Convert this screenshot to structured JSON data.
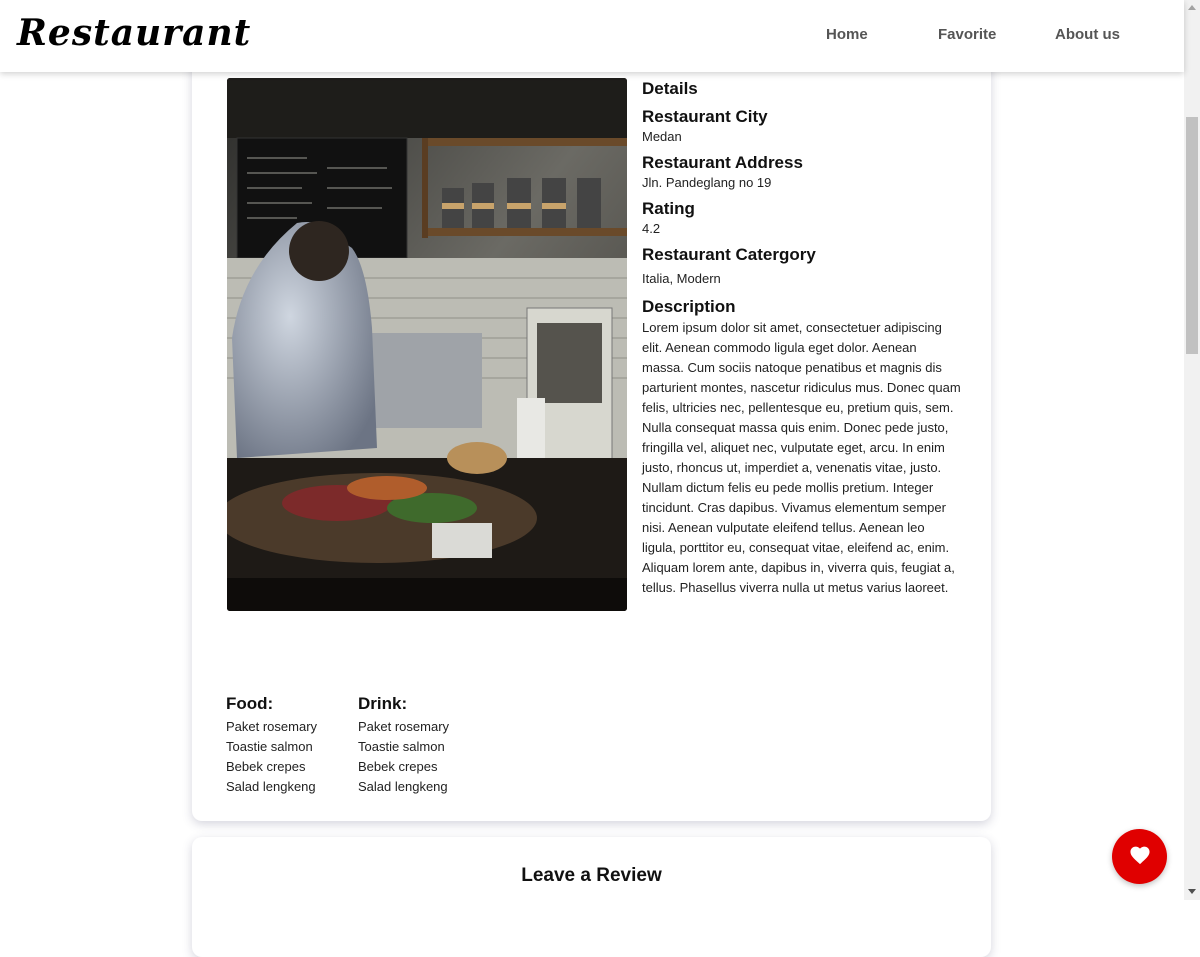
{
  "navbar": {
    "brand": "Restaurant",
    "links": [
      "Home",
      "Favorite",
      "About us"
    ]
  },
  "details": {
    "heading": "Details",
    "city_label": "Restaurant City",
    "city": "Medan",
    "address_label": "Restaurant Address",
    "address": "Jln. Pandeglang no 19",
    "rating_label": "Rating",
    "rating": "4.2",
    "category_label": "Restaurant Catergory",
    "categories": "Italia, Modern",
    "description_label": "Description",
    "description": "Lorem ipsum dolor sit amet, consectetuer adipiscing elit. Aenean commodo ligula eget dolor. Aenean massa. Cum sociis natoque penatibus et magnis dis parturient montes, nascetur ridiculus mus. Donec quam felis, ultricies nec, pellentesque eu, pretium quis, sem. Nulla consequat massa quis enim. Donec pede justo, fringilla vel, aliquet nec, vulputate eget, arcu. In enim justo, rhoncus ut, imperdiet a, venenatis vitae, justo. Nullam dictum felis eu pede mollis pretium. Integer tincidunt. Cras dapibus. Vivamus elementum semper nisi. Aenean vulputate eleifend tellus. Aenean leo ligula, porttitor eu, consequat vitae, eleifend ac, enim. Aliquam lorem ante, dapibus in, viverra quis, feugiat a, tellus. Phasellus viverra nulla ut metus varius laoreet."
  },
  "menus": {
    "food_label": "Food:",
    "food": [
      "Paket rosemary",
      "Toastie salmon",
      "Bebek crepes",
      "Salad lengkeng"
    ],
    "drink_label": "Drink:",
    "drink": [
      "Paket rosemary",
      "Toastie salmon",
      "Bebek crepes",
      "Salad lengkeng"
    ]
  },
  "review": {
    "title": "Leave a Review"
  },
  "colors": {
    "accent": "#e00000"
  },
  "icons": {
    "favorite": "heart-icon"
  }
}
